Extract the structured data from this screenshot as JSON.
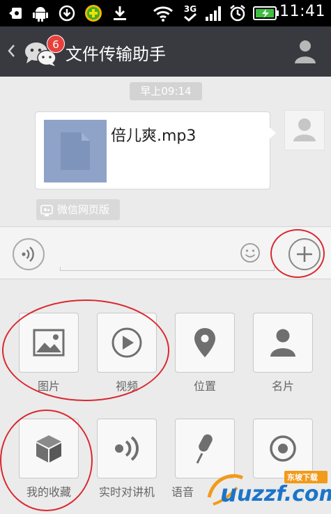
{
  "status_bar": {
    "time": "11:41",
    "network": "3G"
  },
  "title_bar": {
    "title": "文件传输助手",
    "unread_count": "6"
  },
  "chat": {
    "timestamp": "早上09:14",
    "file_name": "倍儿爽.mp3",
    "web_version_label": "微信网页版"
  },
  "panel": {
    "items": [
      {
        "label": "图片",
        "icon": "image-icon"
      },
      {
        "label": "视频",
        "icon": "play-icon"
      },
      {
        "label": "位置",
        "icon": "location-pin-icon"
      },
      {
        "label": "名片",
        "icon": "contact-card-icon"
      },
      {
        "label": "我的收藏",
        "icon": "cube-icon"
      },
      {
        "label": "实时对讲机",
        "icon": "walkie-talkie-icon"
      },
      {
        "label": "语音",
        "icon": "microphone-icon"
      },
      {
        "label": "",
        "icon": "record-icon"
      }
    ]
  },
  "watermark": {
    "text": "uzzf.com",
    "tag": "东坡下载"
  },
  "colors": {
    "title_bar_bg": "#393a3f",
    "badge_red": "#e8413c",
    "annotation_red": "#d9282f",
    "file_thumb_blue": "#8ea3c7"
  }
}
